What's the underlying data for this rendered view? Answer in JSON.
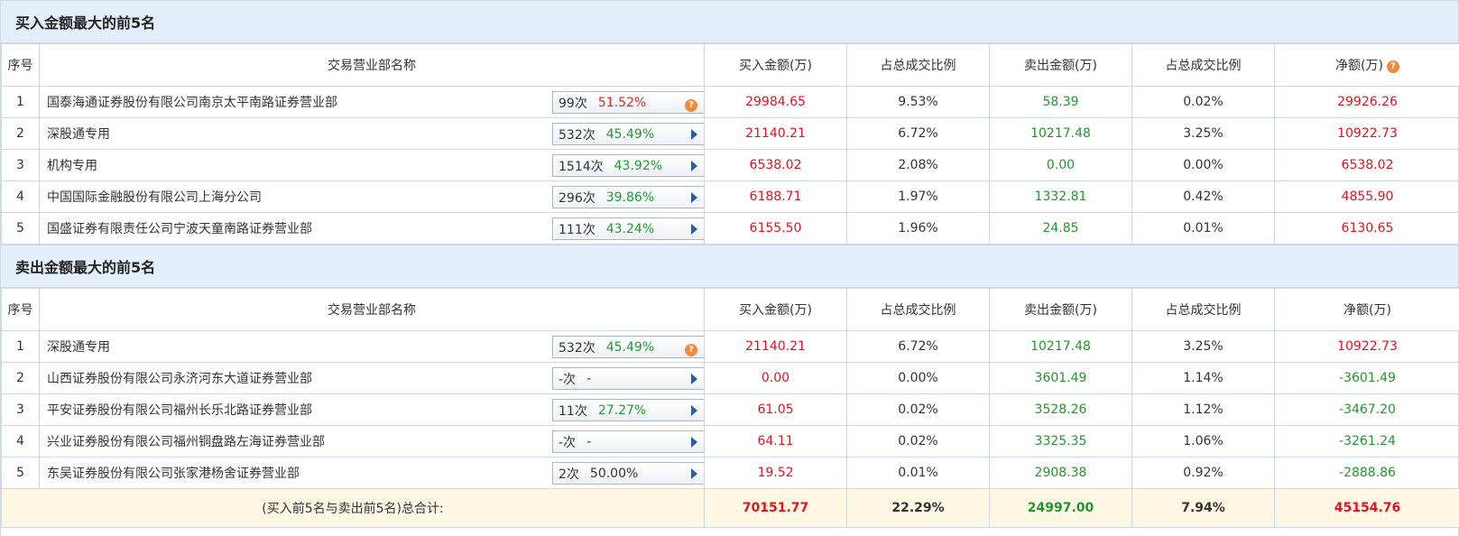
{
  "buy_section": {
    "title": "买入金额最大的前5名",
    "headers": [
      "序号",
      "交易营业部名称",
      "买入金额(万)",
      "占总成交比例",
      "卖出金额(万)",
      "占总成交比例",
      "净额(万)"
    ],
    "rows": [
      {
        "idx": "1",
        "name": "国泰海通证券股份有限公司南京太平南路证券营业部",
        "count": "99次",
        "pct": "51.52%",
        "pct_color": "red",
        "icon": "question-icon",
        "buy": "29984.65",
        "buy_ratio": "9.53%",
        "sell": "58.39",
        "sell_ratio": "0.02%",
        "net": "29926.26",
        "net_color": "red"
      },
      {
        "idx": "2",
        "name": "深股通专用",
        "count": "532次",
        "pct": "45.49%",
        "pct_color": "green",
        "icon": "arrow-right-icon",
        "buy": "21140.21",
        "buy_ratio": "6.72%",
        "sell": "10217.48",
        "sell_ratio": "3.25%",
        "net": "10922.73",
        "net_color": "red"
      },
      {
        "idx": "3",
        "name": "机构专用",
        "count": "1514次",
        "pct": "43.92%",
        "pct_color": "green",
        "icon": "arrow-right-icon",
        "buy": "6538.02",
        "buy_ratio": "2.08%",
        "sell": "0.00",
        "sell_ratio": "0.00%",
        "net": "6538.02",
        "net_color": "red"
      },
      {
        "idx": "4",
        "name": "中国国际金融股份有限公司上海分公司",
        "count": "296次",
        "pct": "39.86%",
        "pct_color": "green",
        "icon": "arrow-right-icon",
        "buy": "6188.71",
        "buy_ratio": "1.97%",
        "sell": "1332.81",
        "sell_ratio": "0.42%",
        "net": "4855.90",
        "net_color": "red"
      },
      {
        "idx": "5",
        "name": "国盛证券有限责任公司宁波天童南路证券营业部",
        "count": "111次",
        "pct": "43.24%",
        "pct_color": "green",
        "icon": "arrow-right-icon",
        "buy": "6155.50",
        "buy_ratio": "1.96%",
        "sell": "24.85",
        "sell_ratio": "0.01%",
        "net": "6130.65",
        "net_color": "red"
      }
    ]
  },
  "sell_section": {
    "title": "卖出金额最大的前5名",
    "headers": [
      "序号",
      "交易营业部名称",
      "买入金额(万)",
      "占总成交比例",
      "卖出金额(万)",
      "占总成交比例",
      "净额(万)"
    ],
    "rows": [
      {
        "idx": "1",
        "name": "深股通专用",
        "count": "532次",
        "pct": "45.49%",
        "pct_color": "green",
        "icon": "question-icon",
        "buy": "21140.21",
        "buy_ratio": "6.72%",
        "sell": "10217.48",
        "sell_ratio": "3.25%",
        "net": "10922.73",
        "net_color": "red"
      },
      {
        "idx": "2",
        "name": "山西证券股份有限公司永济河东大道证券营业部",
        "count": "-次",
        "pct": "-",
        "pct_color": "none",
        "icon": "arrow-right-icon",
        "buy": "0.00",
        "buy_ratio": "0.00%",
        "sell": "3601.49",
        "sell_ratio": "1.14%",
        "net": "-3601.49",
        "net_color": "green"
      },
      {
        "idx": "3",
        "name": "平安证券股份有限公司福州长乐北路证券营业部",
        "count": "11次",
        "pct": "27.27%",
        "pct_color": "green",
        "icon": "arrow-right-icon",
        "buy": "61.05",
        "buy_ratio": "0.02%",
        "sell": "3528.26",
        "sell_ratio": "1.12%",
        "net": "-3467.20",
        "net_color": "green"
      },
      {
        "idx": "4",
        "name": "兴业证券股份有限公司福州铜盘路左海证券营业部",
        "count": "-次",
        "pct": "-",
        "pct_color": "none",
        "icon": "arrow-right-icon",
        "buy": "64.11",
        "buy_ratio": "0.02%",
        "sell": "3325.35",
        "sell_ratio": "1.06%",
        "net": "-3261.24",
        "net_color": "green"
      },
      {
        "idx": "5",
        "name": "东吴证券股份有限公司张家港杨舍证券营业部",
        "count": "2次",
        "pct": "50.00%",
        "pct_color": "none",
        "icon": "arrow-right-icon",
        "buy": "19.52",
        "buy_ratio": "0.01%",
        "sell": "2908.38",
        "sell_ratio": "0.92%",
        "net": "-2888.86",
        "net_color": "green"
      }
    ]
  },
  "total": {
    "label": "(买入前5名与卖出前5名)总合计:",
    "buy": "70151.77",
    "buy_ratio": "22.29%",
    "sell": "24997.00",
    "sell_ratio": "7.94%",
    "net": "45154.76"
  },
  "colors": {
    "red": "#e0141e",
    "green": "#22962d",
    "header_bg": "#e4eefa",
    "total_bg": "#fdf7e3",
    "arrow": "#2d5aa0",
    "question": "#f08a3c"
  },
  "icons": {
    "question": "?"
  }
}
